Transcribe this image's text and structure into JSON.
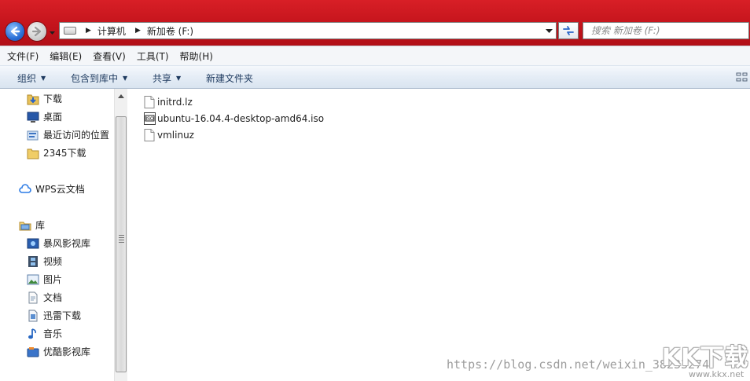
{
  "address": {
    "breadcrumbs": [
      "计算机",
      "新加卷 (F:)"
    ]
  },
  "search": {
    "placeholder": "搜索 新加卷 (F:)"
  },
  "menu": [
    "文件(F)",
    "编辑(E)",
    "查看(V)",
    "工具(T)",
    "帮助(H)"
  ],
  "toolbar": {
    "organize": "组织",
    "include_in_library": "包含到库中",
    "share": "共享",
    "new_folder": "新建文件夹"
  },
  "nav": {
    "favorites": [
      "下载",
      "桌面",
      "最近访问的位置",
      "2345下载"
    ],
    "wps_cloud": "WPS云文档",
    "libraries_header": "库",
    "libraries": [
      "暴风影视库",
      "视频",
      "图片",
      "文档",
      "迅雷下载",
      "音乐",
      "优酷影视库"
    ]
  },
  "files": [
    {
      "name": "initrd.lz",
      "icon": "file-icon"
    },
    {
      "name": "ubuntu-16.04.4-desktop-amd64.iso",
      "icon": "iso-icon"
    },
    {
      "name": "vmlinuz",
      "icon": "file-icon"
    }
  ],
  "watermark": {
    "url": "https://blog.csdn.net/weixin_38233274",
    "logo_text": "KK下载",
    "logo_site": "www.kkx.net"
  },
  "colors": {
    "titlebar": "#c4141c",
    "command_text": "#1e3a5f"
  }
}
